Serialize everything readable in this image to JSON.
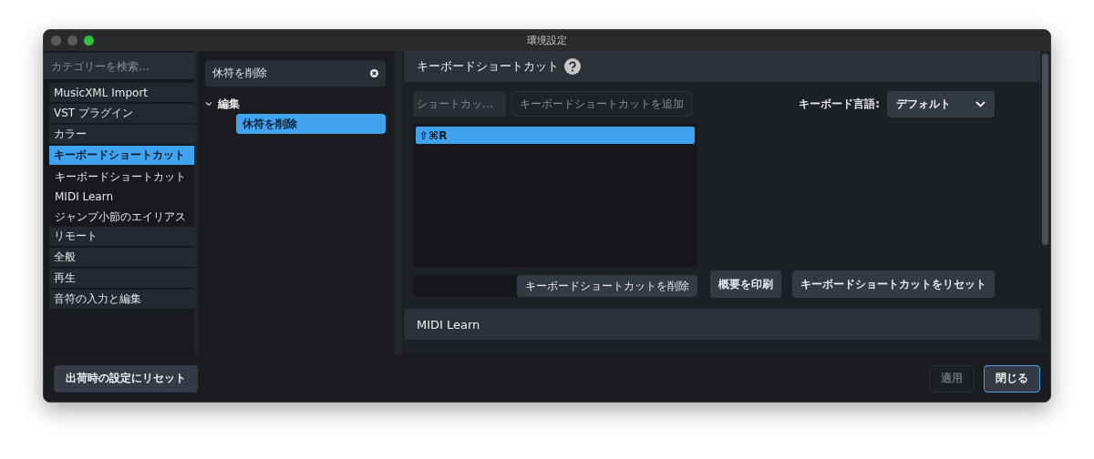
{
  "window": {
    "title": "環境設定"
  },
  "sidebar": {
    "search": {
      "placeholder": "カテゴリーを検索..."
    },
    "items": [
      {
        "label": "MusicXML Import",
        "selected": false
      },
      {
        "label": "VST プラグイン",
        "selected": false
      },
      {
        "label": "カラー",
        "selected": false
      },
      {
        "label": "キーボードショートカット",
        "selected": true,
        "children": [
          {
            "label": "キーボードショートカット"
          },
          {
            "label": "MIDI Learn"
          },
          {
            "label": "ジャンプ小節のエイリアス"
          }
        ]
      },
      {
        "label": "リモート",
        "selected": false
      },
      {
        "label": "全般",
        "selected": false
      },
      {
        "label": "再生",
        "selected": false
      },
      {
        "label": "音符の入力と編集",
        "selected": false
      }
    ]
  },
  "command_search": {
    "value": "休符を削除"
  },
  "tree": [
    {
      "label": "編集",
      "expanded": true,
      "children": [
        {
          "label": "休符を削除",
          "selected": true
        }
      ]
    }
  ],
  "shortcuts_section": {
    "title": "キーボードショートカット",
    "shortcut_field": {
      "placeholder": "ショートカッ…"
    },
    "add_button": "キーボードショートカットを追加",
    "shortcuts": [
      {
        "label": "⇧⌘R",
        "selected": true
      }
    ],
    "remove_button": "キーボードショートカットを削除",
    "language_label": "キーボード言語:",
    "language_value": "デフォルト",
    "print_button": "概要を印刷",
    "reset_button": "キーボードショートカットをリセット"
  },
  "midi_section": {
    "title": "MIDI Learn"
  },
  "footer": {
    "factory_reset_button": "出荷時の設定にリセット",
    "apply_button": {
      "label": "適用",
      "disabled": true
    },
    "close_button": "閉じる"
  }
}
